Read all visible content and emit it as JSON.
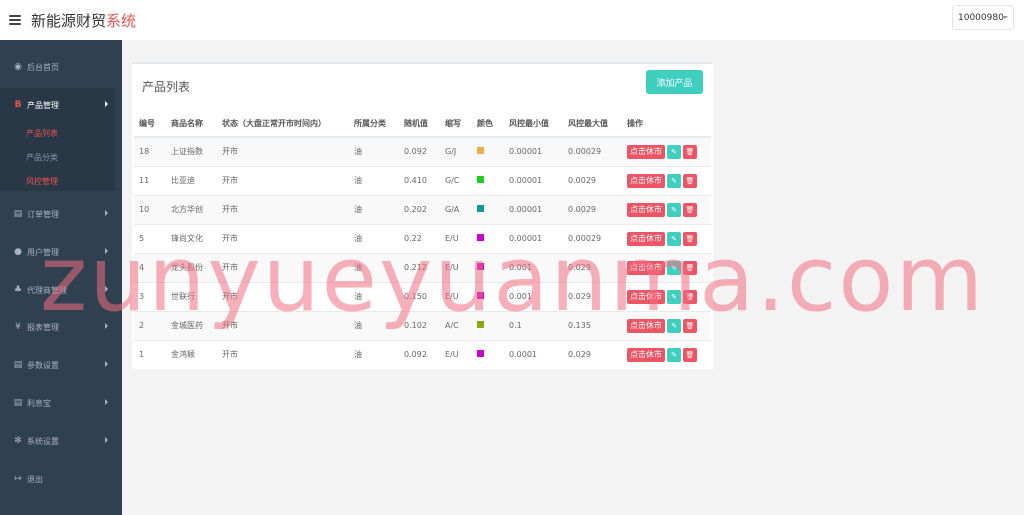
{
  "header": {
    "brand_main": "新能源财贸",
    "brand_accent": "系统",
    "user": "10000980"
  },
  "sidebar": {
    "items": [
      {
        "icon": "dashboard-icon",
        "glyph": "◉",
        "label": "后台首页"
      },
      {
        "icon": "bitcoin-icon",
        "glyph": "B",
        "label": "产品管理"
      },
      {
        "icon": "copy-icon",
        "glyph": "▤",
        "label": "订单管理"
      },
      {
        "icon": "user-icon",
        "glyph": "●",
        "label": "用户管理"
      },
      {
        "icon": "sitemap-icon",
        "glyph": "♣",
        "label": "代理商管理"
      },
      {
        "icon": "yen-icon",
        "glyph": "¥",
        "label": "报表管理"
      },
      {
        "icon": "copy-icon",
        "glyph": "▤",
        "label": "参数设置"
      },
      {
        "icon": "copy-icon",
        "glyph": "▤",
        "label": "利息宝"
      },
      {
        "icon": "gears-icon",
        "glyph": "✻",
        "label": "系统设置"
      },
      {
        "icon": "sign-out-icon",
        "glyph": "↦",
        "label": "退出"
      }
    ],
    "sub_items": [
      {
        "label": "产品列表"
      },
      {
        "label": "产品分类"
      },
      {
        "label": "风控管理"
      }
    ]
  },
  "panel": {
    "title": "产品列表",
    "add_button": "添加产品"
  },
  "table": {
    "headers": [
      "编号",
      "商品名称",
      "状态（大盘正常开市时间内）",
      "所属分类",
      "随机值",
      "缩写",
      "颜色",
      "风控最小值",
      "风控最大值",
      "操作"
    ],
    "rows": [
      {
        "id": "18",
        "name": "上证指数",
        "status": "开市",
        "category": "油",
        "random": "0.092",
        "abbr": "G/J",
        "color": "#f0ad4e",
        "min": "0.00001",
        "max": "0.00029"
      },
      {
        "id": "11",
        "name": "比亚迪",
        "status": "开市",
        "category": "油",
        "random": "0.410",
        "abbr": "G/C",
        "color": "#22cc22",
        "min": "0.00001",
        "max": "0.0029"
      },
      {
        "id": "10",
        "name": "北方华创",
        "status": "开市",
        "category": "油",
        "random": "0.202",
        "abbr": "G/A",
        "color": "#119999",
        "min": "0.00001",
        "max": "0.0029"
      },
      {
        "id": "5",
        "name": "锋尚文化",
        "status": "开市",
        "category": "油",
        "random": "0.22",
        "abbr": "E/U",
        "color": "#cc00cc",
        "min": "0.00001",
        "max": "0.00029"
      },
      {
        "id": "4",
        "name": "龙头股份",
        "status": "开市",
        "category": "油",
        "random": "0.212",
        "abbr": "E/U",
        "color": "#cc00cc",
        "min": "0.001",
        "max": "0.029"
      },
      {
        "id": "3",
        "name": "世联行",
        "status": "开市",
        "category": "油",
        "random": "0.150",
        "abbr": "E/U",
        "color": "#cc00cc",
        "min": "0.001",
        "max": "0.029"
      },
      {
        "id": "2",
        "name": "金城医药",
        "status": "开市",
        "category": "油",
        "random": "0.102",
        "abbr": "A/C",
        "color": "#88aa11",
        "min": "0.1",
        "max": "0.135"
      },
      {
        "id": "1",
        "name": "金鸿颖",
        "status": "开市",
        "category": "油",
        "random": "0.092",
        "abbr": "E/U",
        "color": "#cc00cc",
        "min": "0.0001",
        "max": "0.029"
      }
    ],
    "action_label": "点击休市",
    "edit_icon": "pencil-icon",
    "delete_icon": "trash-icon"
  },
  "watermark": "zunyueyuanma.com"
}
